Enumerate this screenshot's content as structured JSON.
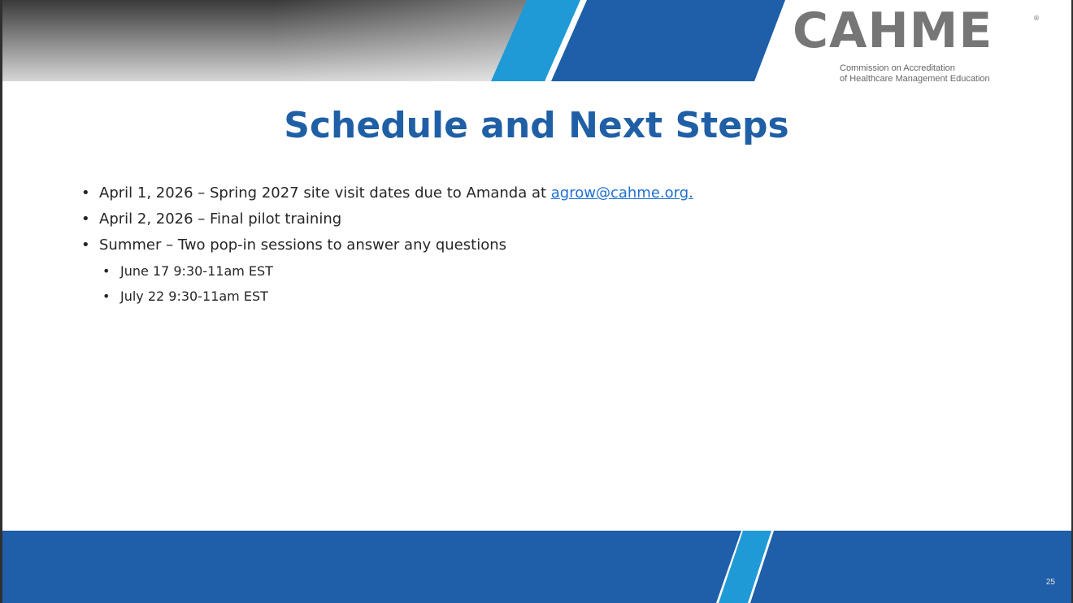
{
  "logo": {
    "wordmark": "CAHME",
    "registered": "®",
    "tagline_line1": "Commission on Accreditation",
    "tagline_line2": "of Healthcare Management Education"
  },
  "title": "Schedule and Next Steps",
  "bullets": [
    {
      "text": "April 1, 2026 – Spring 2027 site visit dates due to Amanda at ",
      "link_text": "agrow@cahme.org."
    },
    {
      "text": "April 2, 2026 – Final pilot training"
    },
    {
      "text": "Summer – Two pop-in sessions to answer any questions",
      "sub": [
        "June 17 9:30-11am EST",
        "July 22 9:30-11am EST"
      ]
    }
  ],
  "bullet_glyph": "•",
  "page_number": "25",
  "colors": {
    "title_blue": "#1f5fa6",
    "band_dark": "#333333",
    "band_blue": "#1f5ea8",
    "accent_light_blue": "#1f9ad6",
    "link_blue": "#1f6fd1",
    "logo_gray": "#767676"
  }
}
